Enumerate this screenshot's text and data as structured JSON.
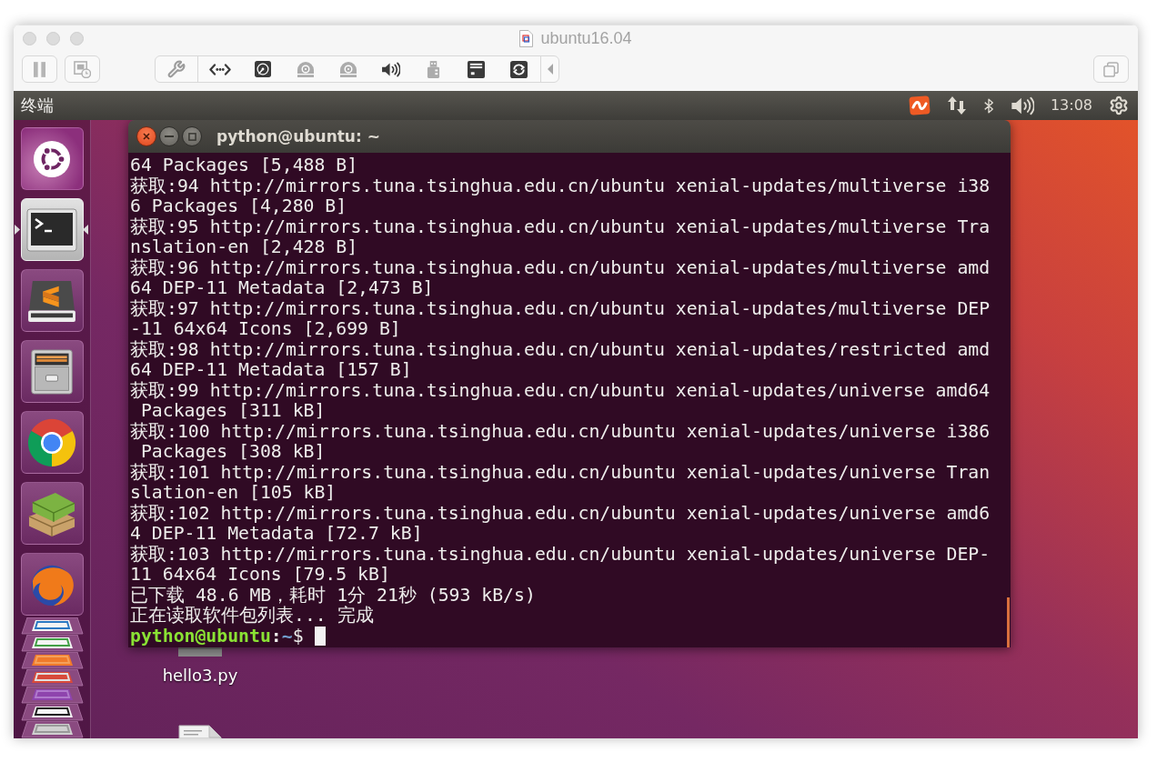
{
  "window": {
    "title": "ubuntu16.04",
    "devices": [
      {
        "kind": "network",
        "connected": true
      },
      {
        "kind": "hard_disk",
        "connected": true
      },
      {
        "kind": "optical",
        "connected": false
      },
      {
        "kind": "optical",
        "connected": false
      },
      {
        "kind": "sound",
        "connected": true
      },
      {
        "kind": "usb",
        "connected": false
      },
      {
        "kind": "floppy",
        "connected": true
      },
      {
        "kind": "shared_folder",
        "connected": true
      }
    ]
  },
  "top_panel": {
    "app_name": "终端",
    "clock": "13:08"
  },
  "launcher": {
    "items": [
      {
        "kind": "home",
        "selected": false
      },
      {
        "kind": "terminal",
        "selected": true
      },
      {
        "kind": "editor",
        "selected": false
      },
      {
        "kind": "files",
        "selected": false
      },
      {
        "kind": "browser",
        "selected": false
      },
      {
        "kind": "books",
        "selected": false
      },
      {
        "kind": "globe",
        "selected": false
      }
    ],
    "stacked": [
      {
        "kind": "document"
      },
      {
        "kind": "spreadsheet"
      },
      {
        "kind": "slides"
      },
      {
        "kind": "tool"
      },
      {
        "kind": "panel"
      },
      {
        "kind": "drive"
      },
      {
        "kind": "trash"
      }
    ]
  },
  "terminal": {
    "title": "python@ubuntu: ~",
    "lines": [
      "64 Packages [5,488 B]",
      "获取:94 http://mirrors.tuna.tsinghua.edu.cn/ubuntu xenial-updates/multiverse i38",
      "6 Packages [4,280 B]",
      "获取:95 http://mirrors.tuna.tsinghua.edu.cn/ubuntu xenial-updates/multiverse Tra",
      "nslation-en [2,428 B]",
      "获取:96 http://mirrors.tuna.tsinghua.edu.cn/ubuntu xenial-updates/multiverse amd",
      "64 DEP-11 Metadata [2,473 B]",
      "获取:97 http://mirrors.tuna.tsinghua.edu.cn/ubuntu xenial-updates/multiverse DEP",
      "-11 64x64 Icons [2,699 B]",
      "获取:98 http://mirrors.tuna.tsinghua.edu.cn/ubuntu xenial-updates/restricted amd",
      "64 DEP-11 Metadata [157 B]",
      "获取:99 http://mirrors.tuna.tsinghua.edu.cn/ubuntu xenial-updates/universe amd64",
      " Packages [311 kB]",
      "获取:100 http://mirrors.tuna.tsinghua.edu.cn/ubuntu xenial-updates/universe i386",
      " Packages [308 kB]",
      "获取:101 http://mirrors.tuna.tsinghua.edu.cn/ubuntu xenial-updates/universe Tran",
      "slation-en [105 kB]",
      "获取:102 http://mirrors.tuna.tsinghua.edu.cn/ubuntu xenial-updates/universe amd6",
      "4 DEP-11 Metadata [72.7 kB]",
      "获取:103 http://mirrors.tuna.tsinghua.edu.cn/ubuntu xenial-updates/universe DEP-",
      "11 64x64 Icons [79.5 kB]",
      "已下载 48.6 MB，耗时 1分 21秒 (593 kB/s)",
      "正在读取软件包列表... 完成"
    ],
    "prompt": {
      "user_host": "python@ubuntu",
      "separator": ":",
      "path": "~",
      "symbol": "$"
    }
  },
  "desktop": {
    "files": [
      {
        "kind": "text",
        "name": "hello3.py"
      },
      {
        "kind": "document"
      }
    ]
  }
}
